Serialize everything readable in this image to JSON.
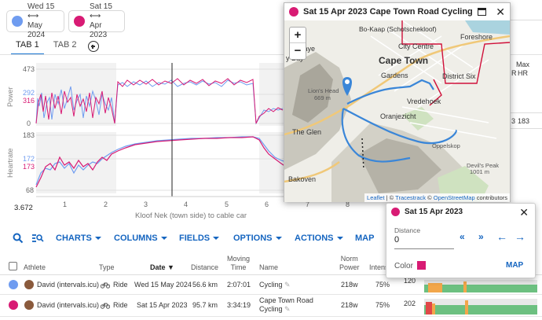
{
  "chips": [
    {
      "line1": "Wed 15 ⟷",
      "line2": "May 2024",
      "color": "#6f9cf0"
    },
    {
      "line1": "Sat 15 ⟷",
      "line2": "Apr 2023",
      "color": "#d81b74"
    }
  ],
  "tabs": [
    "TAB 1",
    "TAB 2"
  ],
  "colors": {
    "series_a": "#6f9cf0",
    "series_b": "#d81b74",
    "accent": "#1565c0"
  },
  "chart": {
    "power": {
      "label": "Power",
      "ticks": {
        "top": "473",
        "blue": "292",
        "pink": "316",
        "bottom": "0"
      }
    },
    "heartrate": {
      "label": "Heartrate",
      "ticks": {
        "top": "183",
        "blue": "172",
        "pink": "173",
        "bottom": "68"
      }
    },
    "x_ticks": [
      "1",
      "2",
      "3",
      "4",
      "5",
      "6",
      "7",
      "8"
    ],
    "cursor_value": "3.672",
    "x_label": "Kloof Nek (town side) to cable car"
  },
  "map_window": {
    "title": "Sat 15 Apr 2023 Cape Town Road Cycling",
    "labels": {
      "bokaap": "Bo-Kaap (Schotschekloof)",
      "foreshore": "Foreshore",
      "city_centre": "City Centre",
      "cape_town": "Cape Town",
      "gardens": "Gardens",
      "district_six": "District Six",
      "vredehoek": "Vredehoek",
      "oranjezicht": "Oranjezicht",
      "the_glen": "The Glen",
      "bakoven": "Bakoven",
      "lions_head": "Lion's Head",
      "lions_head_elev": "669 m",
      "esnaye": "esnaye",
      "y_bay": "y Bay",
      "platteklip": "Platteklip",
      "devils_peak": "Devil's Peak",
      "devils_peak_elev": "1001 m",
      "odelskop": "Oppelskop"
    },
    "zoom_in": "+",
    "zoom_out": "−",
    "attribution": {
      "leaflet": "Leaflet",
      "sep1": " | © ",
      "tracestrack": "Tracestrack",
      "sep2": " © ",
      "osm": "OpenStreetMap",
      "tail": " contributors"
    }
  },
  "right_headers": {
    "max_hr_1": "Max",
    "max_hr_2": "HR",
    "r": "R",
    "val": "183",
    "val2": "3"
  },
  "toolbar": {
    "charts": "CHARTS",
    "columns": "COLUMNS",
    "fields": "FIELDS",
    "options": "OPTIONS",
    "actions": "ACTIONS",
    "map": "MAP"
  },
  "popup": {
    "title": "Sat 15 Apr 2023",
    "distance_label": "Distance",
    "distance_value": "0",
    "color_label": "Color",
    "map_label": "MAP",
    "color": "#d81b74"
  },
  "table": {
    "headers": {
      "athlete": "Athlete",
      "type": "Type",
      "date": "Date ▼",
      "distance": "Distance",
      "moving1": "Moving",
      "moving2": "Time",
      "name": "Name",
      "norm1": "Norm",
      "norm2": "Power",
      "intensity": "Intens"
    },
    "rows": [
      {
        "athlete": "David (intervals.icu)",
        "type": "Ride",
        "date": "Wed 15 May 2024",
        "distance": "56.6 km",
        "moving": "2:07:01",
        "name1": "Cycling",
        "name2": "",
        "power": "218w",
        "intensity": "75%",
        "hr": "120",
        "color": "#6f9cf0"
      },
      {
        "athlete": "David (intervals.icu)",
        "type": "Ride",
        "date": "Sat 15 Apr 2023",
        "distance": "95.7 km",
        "moving": "3:34:19",
        "name1": "Cape Town Road",
        "name2": "Cycling",
        "power": "218w",
        "intensity": "75%",
        "hr": "202",
        "color": "#d81b74"
      }
    ]
  }
}
